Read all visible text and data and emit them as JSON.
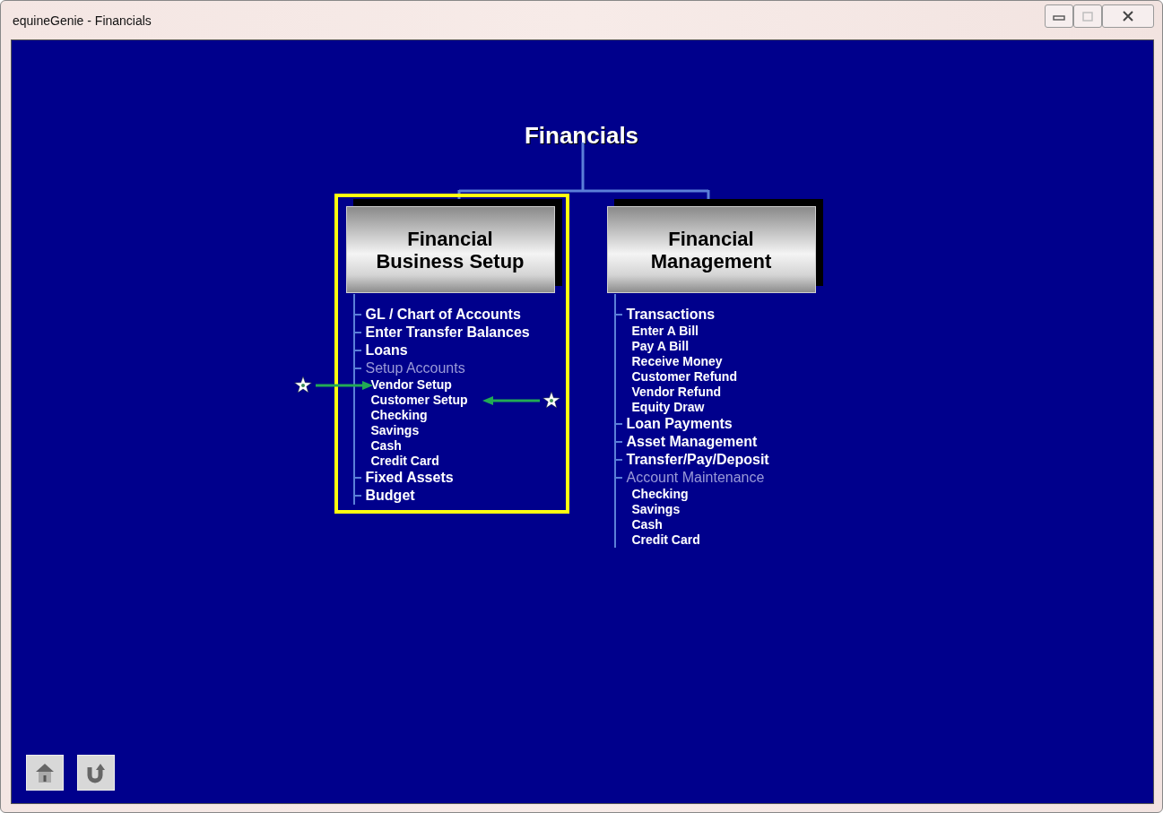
{
  "window": {
    "title": "equineGenie - Financials"
  },
  "heading": "Financials",
  "sections": [
    {
      "title": "Financial Business Setup",
      "highlighted": true,
      "items": [
        {
          "label": "GL / Chart of Accounts",
          "disabled": false
        },
        {
          "label": "Enter Transfer Balances",
          "disabled": false
        },
        {
          "label": "Loans",
          "disabled": false
        },
        {
          "label": "Setup Accounts",
          "disabled": true,
          "children": [
            {
              "label": "Vendor Setup",
              "kind": "arrow_from_left"
            },
            {
              "label": "Customer Setup",
              "kind": "arrow_from_right"
            },
            {
              "label": "Checking",
              "kind": "plain"
            },
            {
              "label": "Savings",
              "kind": "plain"
            },
            {
              "label": "Cash",
              "kind": "plain"
            },
            {
              "label": "Credit Card",
              "kind": "plain"
            }
          ]
        },
        {
          "label": "Fixed Assets",
          "disabled": false
        },
        {
          "label": "Budget",
          "disabled": false
        }
      ]
    },
    {
      "title": "Financial Management",
      "highlighted": false,
      "items": [
        {
          "label": "Transactions",
          "disabled": false,
          "children": [
            {
              "label": "Enter A Bill",
              "kind": "plain"
            },
            {
              "label": "Pay A Bill",
              "kind": "plain"
            },
            {
              "label": "Receive Money",
              "kind": "plain"
            },
            {
              "label": "Customer Refund",
              "kind": "plain"
            },
            {
              "label": "Vendor Refund",
              "kind": "plain"
            },
            {
              "label": "Equity Draw",
              "kind": "plain"
            }
          ]
        },
        {
          "label": "Loan Payments",
          "disabled": false
        },
        {
          "label": "Asset Management",
          "disabled": false
        },
        {
          "label": "Transfer/Pay/Deposit",
          "disabled": false
        },
        {
          "label": "Account Maintenance",
          "disabled": true,
          "children": [
            {
              "label": "Checking",
              "kind": "plain"
            },
            {
              "label": "Savings",
              "kind": "plain"
            },
            {
              "label": "Cash",
              "kind": "plain"
            },
            {
              "label": "Credit Card",
              "kind": "plain"
            }
          ]
        }
      ]
    }
  ]
}
